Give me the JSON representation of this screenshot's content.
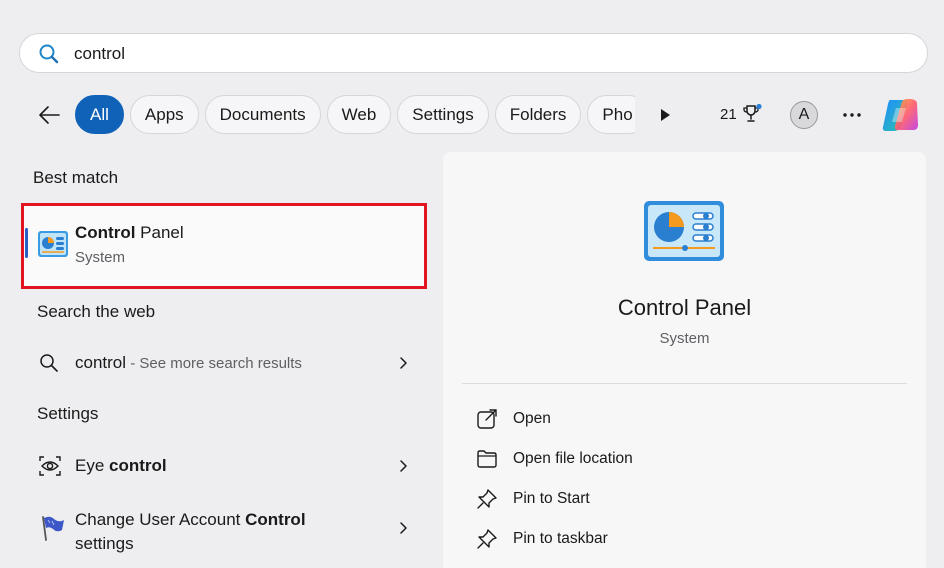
{
  "search": {
    "value": "control",
    "placeholder": ""
  },
  "filters": {
    "chips": [
      {
        "label": "All",
        "active": true
      },
      {
        "label": "Apps",
        "active": false
      },
      {
        "label": "Documents",
        "active": false
      },
      {
        "label": "Web",
        "active": false
      },
      {
        "label": "Settings",
        "active": false
      },
      {
        "label": "Folders",
        "active": false
      },
      {
        "label": "Pho",
        "active": false
      }
    ],
    "points": "21",
    "avatar_letter": "A"
  },
  "best_match": {
    "heading": "Best match",
    "title_bold": "Control",
    "title_rest": " Panel",
    "subtitle": "System"
  },
  "web": {
    "heading": "Search the web",
    "query": "control",
    "hint": " - See more search results"
  },
  "settings": {
    "heading": "Settings",
    "items": [
      {
        "prefix": "Eye ",
        "bold": "control",
        "suffix": "",
        "line2": ""
      },
      {
        "prefix": "Change User Account ",
        "bold": "Control",
        "suffix": "",
        "line2": "settings"
      }
    ]
  },
  "details": {
    "title": "Control Panel",
    "subtitle": "System",
    "actions": [
      {
        "label": "Open",
        "icon": "open-icon"
      },
      {
        "label": "Open file location",
        "icon": "folder-icon"
      },
      {
        "label": "Pin to Start",
        "icon": "pin-icon"
      },
      {
        "label": "Pin to taskbar",
        "icon": "pin-icon"
      }
    ]
  },
  "colors": {
    "accent": "#0f62b8",
    "highlight_border": "#e0141e"
  }
}
